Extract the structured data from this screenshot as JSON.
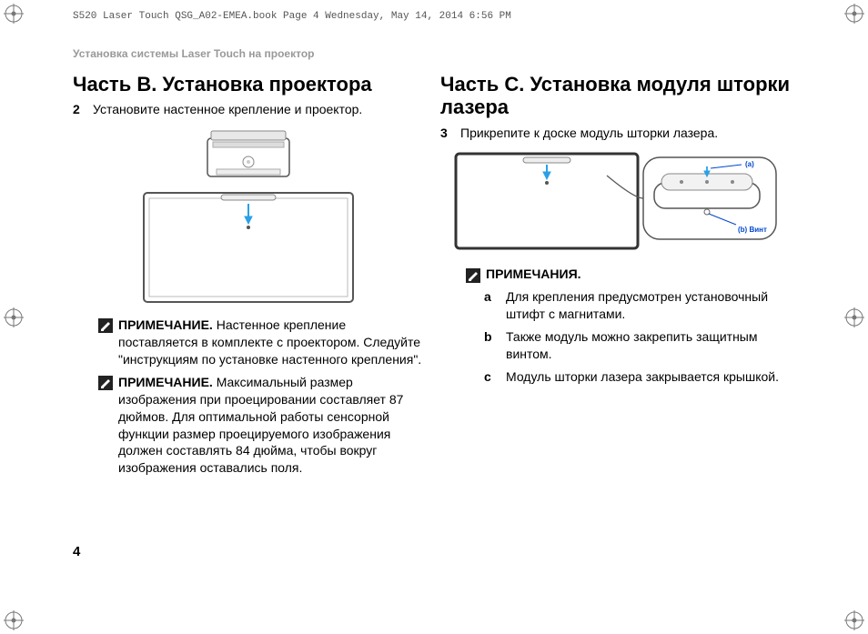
{
  "header_line": "S520 Laser Touch QSG_A02-EMEA.book  Page 4  Wednesday, May 14, 2014  6:56 PM",
  "doc_title": "Установка системы Laser Touch на проектор",
  "left": {
    "heading": "Часть B. Установка проектора",
    "step_num": "2",
    "step_text": "Установите настенное крепление и проектор.",
    "note1_label": "ПРИМЕЧАНИЕ.",
    "note1_text": " Настенное крепление поставляется в комплекте с проектором. Следуйте \"инструкциям по установке настенного крепления\".",
    "note2_label": "ПРИМЕЧАНИЕ.",
    "note2_text": " Максимальный размер изображения при проецировании составляет 87 дюймов. Для оптимальной работы сенсорной функции размер проецируемого изображения должен составлять 84 дюйма, чтобы вокруг изображения оставались поля."
  },
  "right": {
    "heading": "Часть C. Установка модуля шторки лазера",
    "step_num": "3",
    "step_text": "Прикрепите к доске модуль шторки лазера.",
    "callout_a": "(a)",
    "callout_b": "(b) Винт",
    "notes_header": "ПРИМЕЧАНИЯ.",
    "a_letter": "a",
    "a_text": "Для крепления предусмотрен установочный штифт с магнитами.",
    "b_letter": "b",
    "b_text": "Также модуль можно закрепить защитным винтом.",
    "c_letter": "c",
    "c_text": "Модуль шторки лазера закрывается крышкой."
  },
  "page_number": "4"
}
